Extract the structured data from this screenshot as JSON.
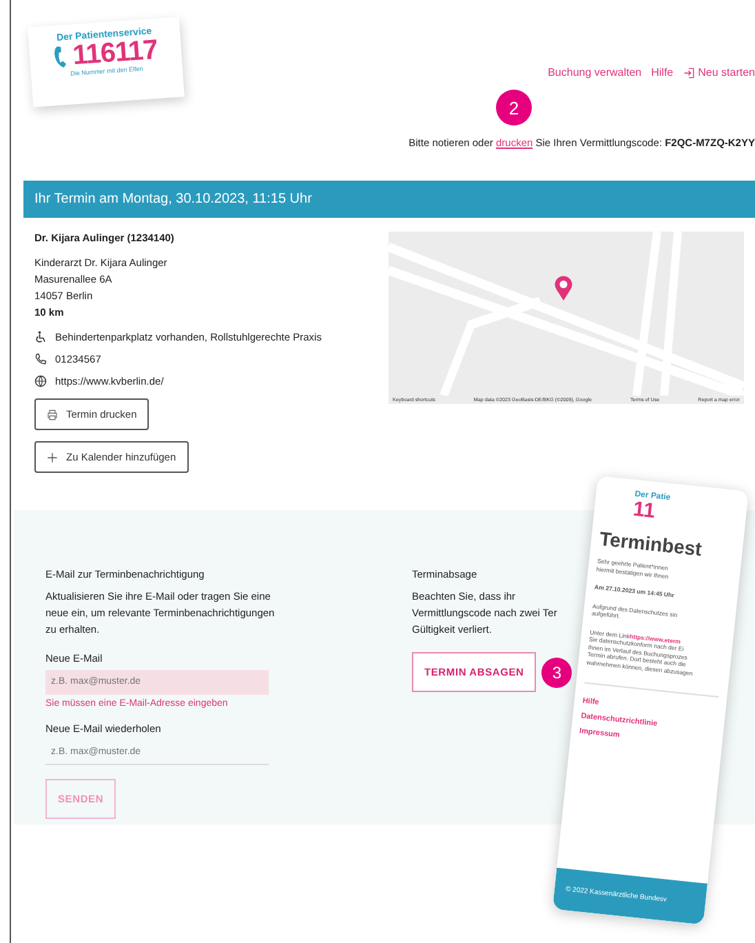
{
  "logo": {
    "title": "Der Patientenservice",
    "number": "116117",
    "tagline": "Die Nummer mit den Elfen"
  },
  "nav": [
    {
      "label": "Buchung verwalten",
      "kind": "link"
    },
    {
      "label": "Hilfe",
      "kind": "link"
    },
    {
      "label": "Neu starten",
      "kind": "restart"
    }
  ],
  "markers": [
    "2",
    "3"
  ],
  "code_notice": {
    "before": "Bitte notieren oder",
    "link": "drucken",
    "after": "Sie Ihren Vermittlungscode:",
    "code": "F2QC-M7ZQ-K2YY"
  },
  "appointment": {
    "title": "Ihr Termin am Montag, 30.10.2023, 11:15 Uhr",
    "doctor": "Dr. Kijara Aulinger (1234140)",
    "address": [
      "Kinderarzt Dr. Kijara Aulinger",
      "Masurenallee 6A",
      "14057 Berlin"
    ],
    "distance": "10 km",
    "details": [
      {
        "kind": "accessibility",
        "text": "Behindertenparkplatz vorhanden, Rollstuhlgerechte Praxis"
      },
      {
        "kind": "phone",
        "text": "01234567"
      },
      {
        "kind": "web",
        "text": "https://www.kvberlin.de/"
      }
    ],
    "buttons": [
      {
        "kind": "print",
        "label": "Termin drucken"
      },
      {
        "kind": "add",
        "label": "Zu Kalender hinzufügen"
      }
    ],
    "map": {
      "attribution": [
        "Keyboard shortcuts",
        "Map data ©2023 GeoBasis-DE/BKG (©2009), Google",
        "Terms of Use",
        "Report a map error"
      ]
    }
  },
  "email": {
    "title": "E-Mail zur Terminbenachrichtigung",
    "description": "Aktualisieren Sie ihre E-Mail oder tragen Sie eine neue ein, um relevante Terminbenachrichtigungen zu erhalten.",
    "fields": [
      {
        "label": "Neue E-Mail",
        "placeholder": "z.B. max@muster.de",
        "error": "Sie müssen eine E-Mail-Adresse eingeben"
      },
      {
        "label": "Neue E-Mail wiederholen",
        "placeholder": "z.B. max@muster.de"
      }
    ],
    "submit": {
      "label": "SENDEN",
      "disabled": true
    }
  },
  "cancel": {
    "title": "Terminabsage",
    "description": [
      "Beachten Sie, dass ihr Vermittlungscode nach zwei Ter",
      "Gültigkeit verliert."
    ],
    "button": "TERMIN ABSAGEN"
  },
  "email_preview": {
    "logo_title": "Der Patie",
    "logo_number": "11",
    "heading": "Terminbest",
    "paragraphs": [
      {
        "kind": "text",
        "lines": [
          "Sehr geehrte Patient*innen",
          "hiermit bestätigen wir Ihnen"
        ]
      },
      {
        "kind": "bold",
        "lines": [
          "Am 27.10.2023 um 14:45 Uhr"
        ]
      },
      {
        "kind": "text",
        "lines": [
          "Aufgrund des Datenschutzes sin",
          "aufgeführt."
        ]
      },
      {
        "kind": "link",
        "link": "https://www.eterm",
        "lines": [
          "Unter dem Link",
          "Sie datenschutzkonform nach der Ei",
          "Ihnen im Verlauf des Buchungsprozes",
          "Termin abrufen. Dort besteht auch die",
          "wahrnehmen können, diesen abzusagen"
        ]
      }
    ],
    "links": [
      "Hilfe",
      "Datenschutzrichtlinie",
      "Impressum"
    ],
    "footer": "© 2022 Kassenärztliche Bundesv"
  }
}
